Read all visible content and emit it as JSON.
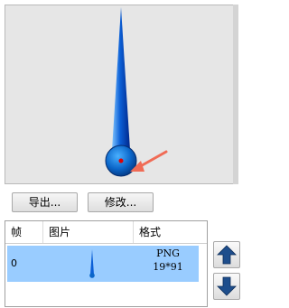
{
  "toolbar": {
    "export_label": "导出...",
    "edit_label": "修改..."
  },
  "frame_list": {
    "columns": [
      "帧",
      "图片",
      "格式"
    ],
    "rows": [
      {
        "frame": "0",
        "format_type": "PNG",
        "format_size": "19*91"
      }
    ]
  },
  "colors": {
    "selected_row": "#99ccff",
    "needle_blue": "#0b5fd6",
    "annotation_arrow": "#f06b55",
    "pivot_dot": "#e00000"
  },
  "icons": [
    "move-up-icon",
    "move-down-icon",
    "needle-image",
    "annotation-arrow"
  ]
}
